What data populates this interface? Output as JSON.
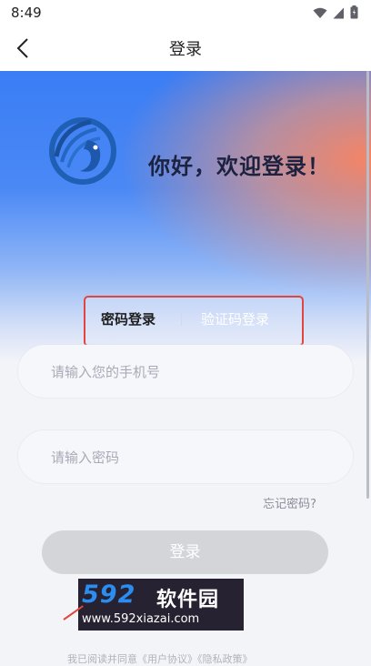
{
  "status_bar": {
    "time": "8:49"
  },
  "nav": {
    "title": "登录"
  },
  "hero": {
    "greeting": "你好，欢迎登录！"
  },
  "tabs": {
    "password_label": "密码登录",
    "sms_label": "验证码登录"
  },
  "form": {
    "phone_placeholder": "请输入您的手机号",
    "password_placeholder": "请输入密码",
    "forgot_label": "忘记密码?",
    "login_label": "登录"
  },
  "watermark": {
    "brand_digits": "592",
    "brand_text": "软件园",
    "url": "www.592xiazai.com"
  },
  "agreement": {
    "text": "我已阅读并同意《用户协议》《隐私政策》"
  },
  "colors": {
    "primary_blue": "#3a7df5",
    "accent_red": "#e0463f",
    "button_disabled": "#d3d5d9"
  }
}
